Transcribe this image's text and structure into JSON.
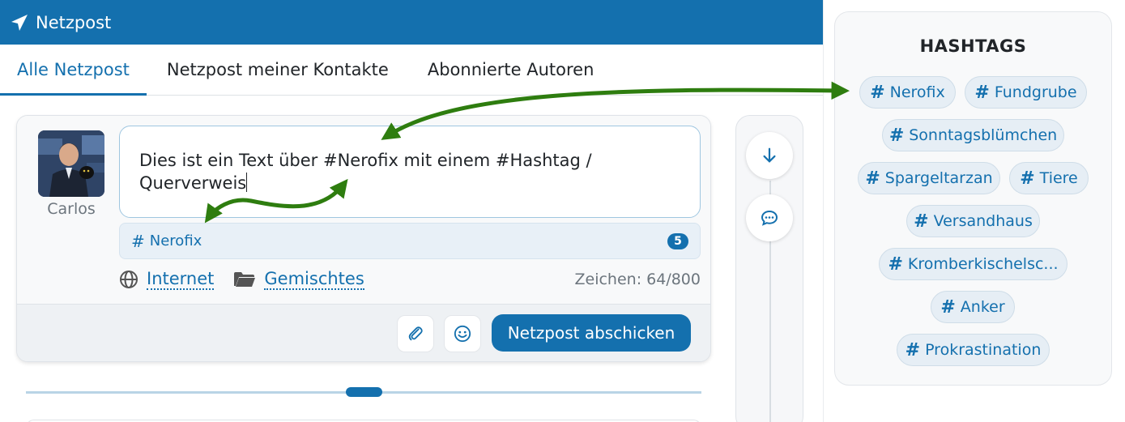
{
  "header": {
    "title": "Netzpost"
  },
  "tabs": [
    {
      "label": "Alle Netzpost",
      "active": true
    },
    {
      "label": "Netzpost meiner Kontakte",
      "active": false
    },
    {
      "label": "Abonnierte Autoren",
      "active": false
    }
  ],
  "composer": {
    "author": "Carlos",
    "text": "Dies ist ein Text über #Nerofix mit einem #Hashtag / Querverweis",
    "suggestion": {
      "tag": "Nerofix",
      "count": "5"
    },
    "visibility": "Internet",
    "category": "Gemischtes",
    "char_counter": "Zeichen: 64/800",
    "submit_label": "Netzpost abschicken"
  },
  "sidebar": {
    "title": "HASHTAGS",
    "tags": [
      "Nerofix",
      "Fundgrube",
      "Sonntagsblümchen",
      "Spargeltarzan",
      "Tiere",
      "Versandhaus",
      "Kromberkischelsc...",
      "Anker",
      "Prokrastination"
    ]
  },
  "colors": {
    "primary": "#1470ae",
    "annotation_arrow": "#2e7d0f",
    "chip_bg": "#e6eef5"
  },
  "icons": [
    "paper-plane-icon",
    "globe-icon",
    "folder-icon",
    "paperclip-icon",
    "smiley-icon",
    "arrow-down-icon",
    "comment-icon",
    "hash-icon"
  ]
}
